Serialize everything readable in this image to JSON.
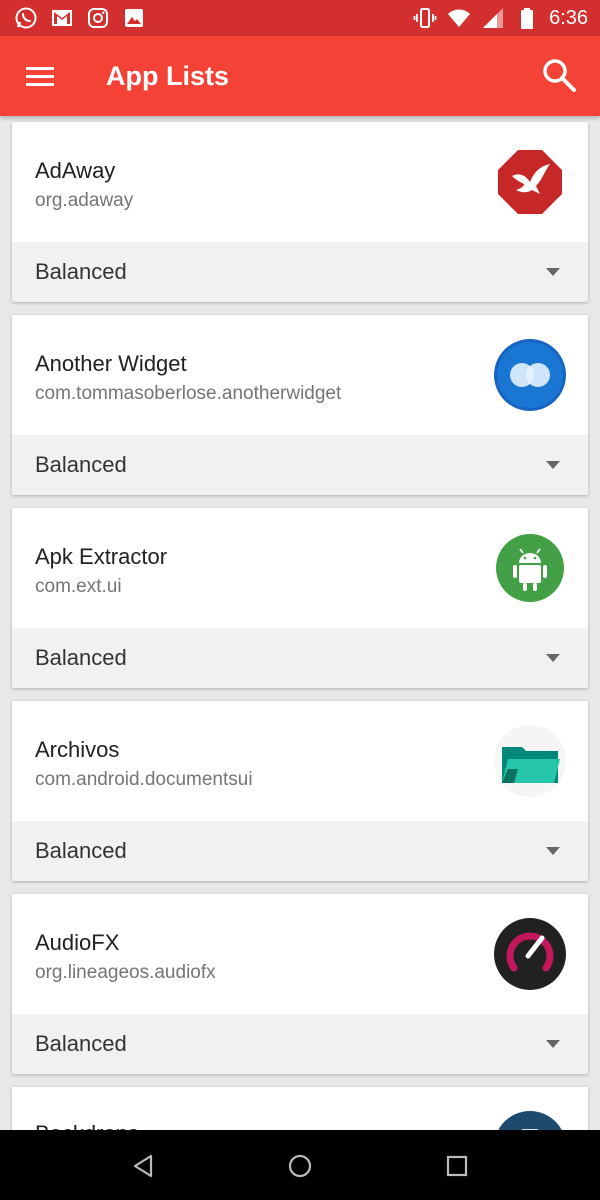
{
  "status_bar": {
    "time": "6:36",
    "notification_icons": [
      "whatsapp-icon",
      "gmail-icon",
      "instagram-icon",
      "gallery-icon"
    ],
    "system_icons": [
      "vibrate-icon",
      "wifi-icon",
      "signal-icon",
      "battery-icon"
    ]
  },
  "app_bar": {
    "title": "App Lists",
    "menu_icon": "hamburger-menu-icon",
    "search_icon": "search-icon",
    "color": "#f44336"
  },
  "apps": [
    {
      "name": "AdAway",
      "package": "org.adaway",
      "profile": "Balanced",
      "icon": "adaway-icon"
    },
    {
      "name": "Another Widget",
      "package": "com.tommasoberlose.anotherwidget",
      "profile": "Balanced",
      "icon": "another-widget-icon"
    },
    {
      "name": "Apk Extractor",
      "package": "com.ext.ui",
      "profile": "Balanced",
      "icon": "apk-extractor-icon"
    },
    {
      "name": "Archivos",
      "package": "com.android.documentsui",
      "profile": "Balanced",
      "icon": "archivos-icon"
    },
    {
      "name": "AudioFX",
      "package": "org.lineageos.audiofx",
      "profile": "Balanced",
      "icon": "audiofx-icon"
    }
  ],
  "partial_app": {
    "name": "Backdrops",
    "icon": "backdrops-icon"
  },
  "nav_bar": {
    "buttons": [
      "back-icon",
      "home-icon",
      "recents-icon"
    ]
  }
}
